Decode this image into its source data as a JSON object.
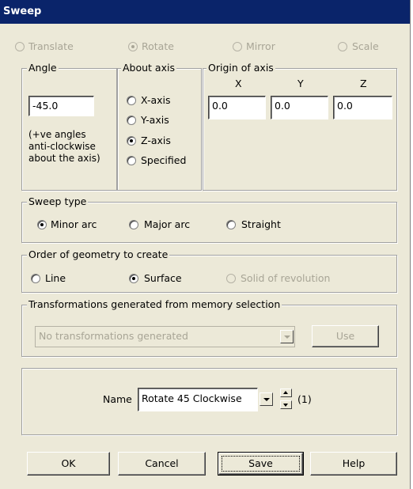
{
  "window": {
    "title": "Sweep"
  },
  "mode": {
    "options": [
      {
        "label": "Translate",
        "selected": false,
        "enabled": false
      },
      {
        "label": "Rotate",
        "selected": true,
        "enabled": false
      },
      {
        "label": "Mirror",
        "selected": false,
        "enabled": false
      },
      {
        "label": "Scale",
        "selected": false,
        "enabled": false
      }
    ]
  },
  "angle": {
    "legend": "Angle",
    "value": "-45.0",
    "note_line1": "(+ve angles",
    "note_line2": "anti-clockwise",
    "note_line3": "about the axis)"
  },
  "about_axis": {
    "legend": "About axis",
    "options": [
      {
        "label": "X-axis",
        "selected": false
      },
      {
        "label": "Y-axis",
        "selected": false
      },
      {
        "label": "Z-axis",
        "selected": true
      },
      {
        "label": "Specified",
        "selected": false
      }
    ]
  },
  "origin": {
    "legend": "Origin of axis",
    "x_label": "X",
    "y_label": "Y",
    "z_label": "Z",
    "x_value": "0.0",
    "y_value": "0.0",
    "z_value": "0.0"
  },
  "sweep_type": {
    "legend": "Sweep type",
    "options": [
      {
        "label": "Minor arc",
        "selected": true
      },
      {
        "label": "Major arc",
        "selected": false
      },
      {
        "label": "Straight",
        "selected": false
      }
    ]
  },
  "geometry_order": {
    "legend": "Order of geometry to create",
    "options": [
      {
        "label": "Line",
        "selected": false,
        "enabled": true
      },
      {
        "label": "Surface",
        "selected": true,
        "enabled": true
      },
      {
        "label": "Solid of revolution",
        "selected": false,
        "enabled": false
      }
    ]
  },
  "transformations": {
    "legend": "Transformations generated from memory selection",
    "dropdown_value": "No transformations generated",
    "use_label": "Use"
  },
  "name_row": {
    "label": "Name",
    "value": "Rotate 45 Clockwise",
    "count": "(1)"
  },
  "buttons": {
    "ok": "OK",
    "cancel": "Cancel",
    "save": "Save",
    "help": "Help"
  }
}
